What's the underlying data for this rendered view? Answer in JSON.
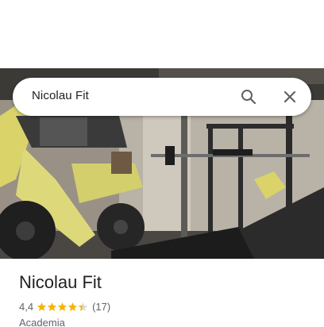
{
  "search": {
    "query": "Nicolau Fit"
  },
  "place": {
    "name": "Nicolau Fit",
    "rating": "4,4",
    "rating_value": 4.4,
    "stars_max": 5,
    "review_count": "(17)",
    "category": "Academia"
  },
  "icons": {
    "search": "search-icon",
    "close": "close-icon",
    "star": "star-icon"
  },
  "colors": {
    "star": "#f4b400",
    "text_primary": "#202124",
    "text_secondary": "#5f6368",
    "icon": "#5f6368"
  }
}
